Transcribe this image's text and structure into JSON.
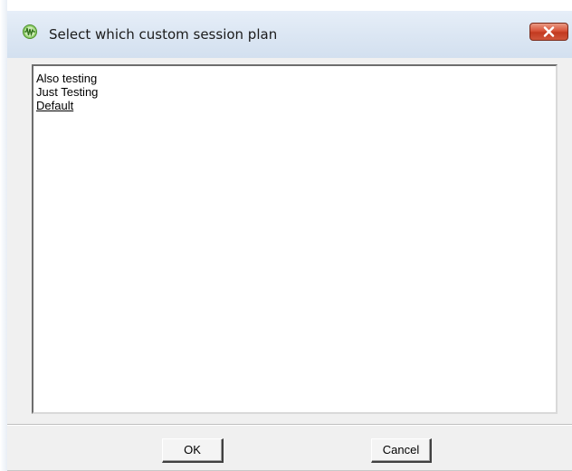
{
  "window": {
    "title": "Select which custom session plan",
    "icon": "app-waveform-icon",
    "close_icon": "close-icon",
    "accent_colors": {
      "titlebar": "#dbe6f3",
      "close_button": "#d8543a",
      "face": "#f0f0f0"
    }
  },
  "list": {
    "items": [
      "Also testing",
      "Just Testing",
      "Default"
    ],
    "underlined_item": "Default"
  },
  "buttons": {
    "ok_label": "OK",
    "cancel_label": "Cancel"
  }
}
